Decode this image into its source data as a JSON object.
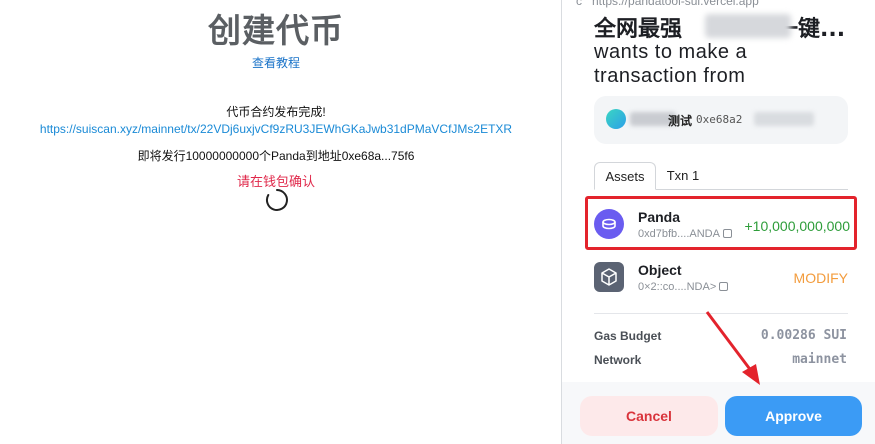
{
  "left_page": {
    "title": "创建代币",
    "tutorial_link": "查看教程",
    "status_done": "代币合约发布完成!",
    "tx_link": "https://suiscan.xyz/mainnet/tx/22VDj6uxjvCf9zRU3JEWhGKaJwb31dPMaVCfJMs2ETXR",
    "issue_text": "即将发行10000000000个Panda到地址0xe68a...75f6",
    "confirm_text": "请在钱包确认"
  },
  "wallet": {
    "url": "https://pandatool-sui.vercel.app",
    "dapp_name": "全网最强",
    "dapp_name_suffix": "一键...",
    "want_line_1": "wants to make a",
    "want_line_2": "transaction from",
    "account": {
      "name": "测试",
      "address": "0xe68a2"
    },
    "tabs": [
      "Assets",
      "Txn 1"
    ],
    "assets": [
      {
        "name": "Panda",
        "sub": "0xd7bfb....ANDA",
        "amount": "+10,000,000,000",
        "icon": "coin-icon"
      },
      {
        "name": "Object",
        "sub": "0×2::co....NDA>",
        "amount": "MODIFY",
        "icon": "cube-icon"
      }
    ],
    "gas_budget_label": "Gas Budget",
    "gas_budget_value": "0.00286 SUI",
    "network_label": "Network",
    "network_value": "mainnet",
    "cancel_label": "Cancel",
    "approve_label": "Approve"
  },
  "colors": {
    "accent_blue": "#3b9bf5",
    "highlight_red": "#e3232c",
    "amount_green": "#2e9d3a",
    "modify_orange": "#f39c3d"
  }
}
